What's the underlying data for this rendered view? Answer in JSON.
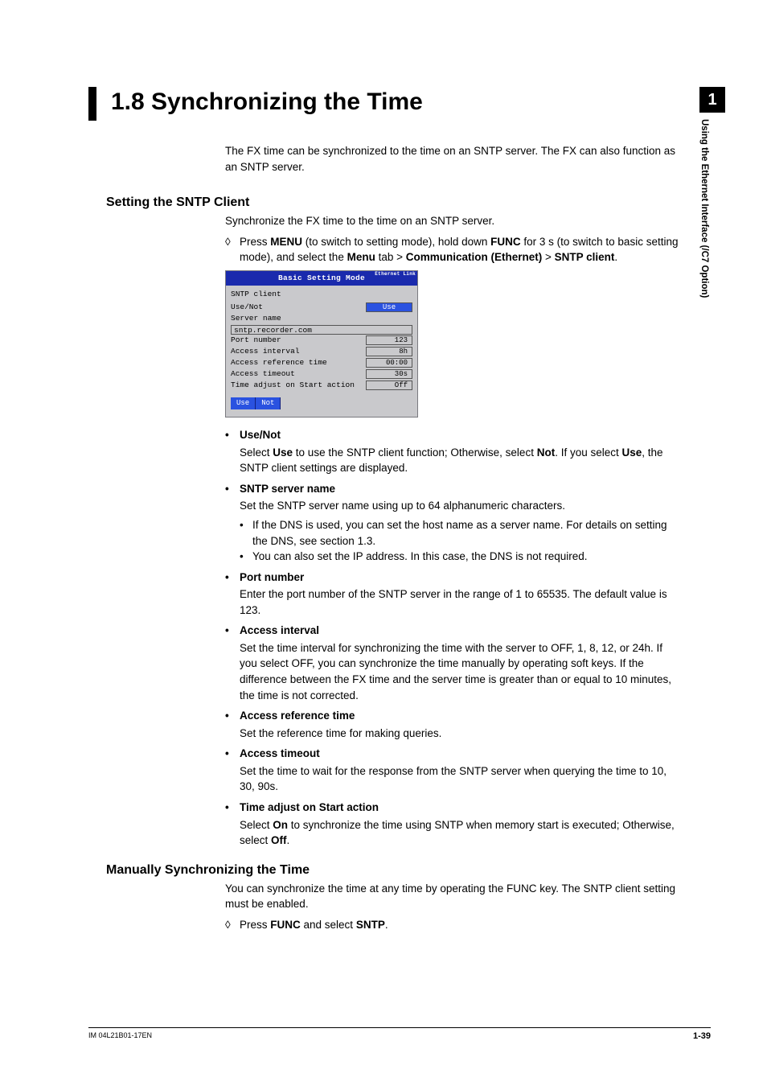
{
  "sideTab": {
    "chapter": "1",
    "label": "Using the Ethernet Interface (/C7 Option)"
  },
  "heading": "1.8    Synchronizing the Time",
  "intro": "The FX time can be synchronized to the time on an SNTP server. The FX can also function as an SNTP server.",
  "sectA": {
    "title": "Setting the SNTP Client",
    "sub": "Synchronize the FX time to the time on an SNTP server.",
    "procMark": "◊",
    "proc_pre": "Press ",
    "proc_b1": "MENU",
    "proc_mid1": " (to switch to setting mode), hold down ",
    "proc_b2": "FUNC",
    "proc_mid2": " for 3 s (to switch to basic setting mode), and select the ",
    "proc_b3": "Menu",
    "proc_mid3": " tab > ",
    "proc_b4": "Communication (Ethernet)",
    "proc_mid4": " > ",
    "proc_b5": "SNTP client",
    "proc_end": "."
  },
  "screenshot": {
    "title": "Basic Setting Mode",
    "badge": "Ethernet\nLink",
    "header": "SNTP client",
    "rows": {
      "useNot": {
        "label": "Use/Not",
        "value": "Use"
      },
      "serverLabel": "Server name",
      "serverVal": "sntp.recorder.com",
      "port": {
        "label": "Port number",
        "value": "123"
      },
      "interval": {
        "label": "Access interval",
        "value": "8h"
      },
      "refTime": {
        "label": "Access reference time",
        "value": "00:00"
      },
      "timeout": {
        "label": "Access timeout",
        "value": "30s"
      },
      "adjStart": {
        "label": "Time adjust on Start action",
        "value": "Off"
      }
    },
    "btn1": "Use",
    "btn2": "Not"
  },
  "items": {
    "i1": {
      "title": "Use/Not",
      "d_pre": "Select ",
      "d_b1": "Use",
      "d_mid1": " to use the SNTP client function; Otherwise, select ",
      "d_b2": "Not",
      "d_mid2": ". If you select ",
      "d_b3": "Use",
      "d_end": ", the SNTP client settings are displayed."
    },
    "i2": {
      "title": "SNTP server name",
      "desc": "Set the SNTP server name using up to 64 alphanumeric characters.",
      "s1": "If the DNS is used, you can set the host name as a server name. For details on setting the DNS, see section 1.3.",
      "s2": "You can also set the IP address. In this case, the DNS is not required."
    },
    "i3": {
      "title": "Port number",
      "desc": "Enter the port number of the SNTP server in the range of 1 to 65535. The default value is 123."
    },
    "i4": {
      "title": "Access interval",
      "desc": "Set the time interval for synchronizing the time with the server to OFF, 1, 8, 12, or 24h. If you select OFF, you can synchronize the time manually by operating soft keys. If the difference between the FX time and the server time is greater than or equal to 10 minutes, the time is not corrected."
    },
    "i5": {
      "title": "Access reference time",
      "desc": "Set the reference time for making queries."
    },
    "i6": {
      "title": "Access timeout",
      "desc": "Set the time to wait for the response from the SNTP server when querying the time to 10, 30, 90s."
    },
    "i7": {
      "title": "Time adjust on Start action",
      "d_pre": "Select ",
      "d_b1": "On",
      "d_mid1": " to synchronize the time using SNTP when memory start is executed; Otherwise, select ",
      "d_b2": "Off",
      "d_end": "."
    }
  },
  "sectB": {
    "title": "Manually Synchronizing the Time",
    "sub": "You can synchronize the time at any time by operating the FUNC key. The SNTP client setting must be enabled.",
    "procMark": "◊",
    "p_pre": "Press ",
    "p_b1": "FUNC",
    "p_mid": " and select ",
    "p_b2": "SNTP",
    "p_end": "."
  },
  "footer": {
    "left": "IM 04L21B01-17EN",
    "right": "1-39"
  },
  "bulletChar": "•",
  "subBulletChar": "•"
}
